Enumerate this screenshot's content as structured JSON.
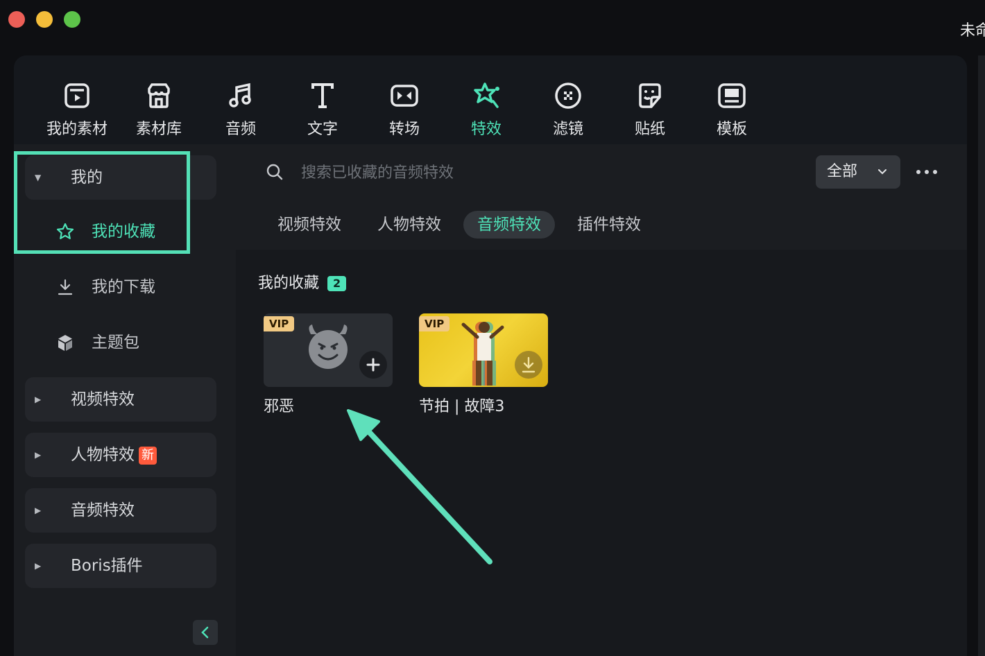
{
  "window": {
    "title": "未命"
  },
  "toolbar": {
    "items": [
      {
        "label": "我的素材",
        "icon": "my-media-icon"
      },
      {
        "label": "素材库",
        "icon": "store-icon"
      },
      {
        "label": "音频",
        "icon": "music-icon"
      },
      {
        "label": "文字",
        "icon": "text-icon"
      },
      {
        "label": "转场",
        "icon": "transition-icon"
      },
      {
        "label": "特效",
        "icon": "effects-icon",
        "active": true
      },
      {
        "label": "滤镜",
        "icon": "filter-icon"
      },
      {
        "label": "贴纸",
        "icon": "sticker-icon"
      },
      {
        "label": "模板",
        "icon": "template-icon"
      }
    ],
    "accent": "#4ee3b8"
  },
  "sidebar": {
    "mine": "我的",
    "favorites": "我的收藏",
    "downloads": "我的下载",
    "themes": "主题包",
    "groups": [
      {
        "label": "视频特效"
      },
      {
        "label": "人物特效",
        "badge": "新"
      },
      {
        "label": "音频特效"
      },
      {
        "label": "Boris插件"
      }
    ]
  },
  "search": {
    "placeholder": "搜索已收藏的音频特效",
    "filter": "全部"
  },
  "tabs": [
    {
      "label": "视频特效"
    },
    {
      "label": "人物特效"
    },
    {
      "label": "音频特效",
      "active": true
    },
    {
      "label": "插件特效"
    }
  ],
  "section": {
    "title": "我的收藏",
    "count": "2"
  },
  "cards": [
    {
      "name": "邪恶",
      "vip": "VIP"
    },
    {
      "name": "节拍 | 故障3",
      "vip": "VIP"
    }
  ],
  "colors": {
    "highlight": "#54e0b6",
    "vip": "#f1c983",
    "new_badge": "#ff5a3c"
  }
}
